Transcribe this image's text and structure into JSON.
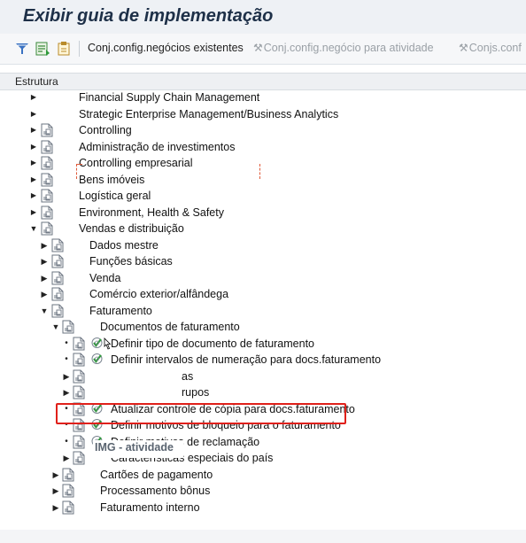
{
  "title": "Exibir guia de implementação",
  "toolbar": {
    "icons": [
      "filter-icon",
      "find-icon",
      "info-icon"
    ],
    "buttons": [
      {
        "label": "Conj.config.negócios existentes",
        "enabled": true
      },
      {
        "label": "Conj.config.negócio para atividade",
        "enabled": false
      },
      {
        "label": "Conjs.conf",
        "enabled": false
      }
    ]
  },
  "tree": {
    "header": "Estrutura",
    "rows": [
      {
        "label": "Financial Supply Chain Management",
        "level": 0,
        "expander": "collapsed",
        "icon": "none"
      },
      {
        "label": "Strategic Enterprise Management/Business Analytics",
        "level": 0,
        "expander": "collapsed",
        "icon": "none"
      },
      {
        "label": "Controlling",
        "level": 0,
        "expander": "collapsed",
        "icon": "doc"
      },
      {
        "label": "Administração de investimentos",
        "level": 0,
        "expander": "collapsed",
        "icon": "doc"
      },
      {
        "label": "Controlling empresarial",
        "level": 0,
        "expander": "collapsed",
        "icon": "doc"
      },
      {
        "label": "Bens imóveis",
        "level": 0,
        "expander": "collapsed",
        "icon": "doc"
      },
      {
        "label": "Logística geral",
        "level": 0,
        "expander": "collapsed",
        "icon": "doc"
      },
      {
        "label": "Environment, Health & Safety",
        "level": 0,
        "expander": "collapsed",
        "icon": "doc"
      },
      {
        "label": "Vendas e distribuição",
        "level": 0,
        "expander": "expanded",
        "icon": "doc"
      },
      {
        "label": "Dados mestre",
        "level": 1,
        "expander": "collapsed",
        "icon": "doc"
      },
      {
        "label": "Funções básicas",
        "level": 1,
        "expander": "collapsed",
        "icon": "doc"
      },
      {
        "label": "Venda",
        "level": 1,
        "expander": "collapsed",
        "icon": "doc"
      },
      {
        "label": "Comércio exterior/alfândega",
        "level": 1,
        "expander": "collapsed",
        "icon": "doc"
      },
      {
        "label": "Faturamento",
        "level": 1,
        "expander": "expanded",
        "icon": "doc"
      },
      {
        "label": "Documentos de faturamento",
        "level": 2,
        "expander": "expanded",
        "icon": "doc"
      },
      {
        "label": "Definir tipo de documento de faturamento",
        "level": 3,
        "expander": "leaf",
        "icon": "doc-activity"
      },
      {
        "label": "Definir intervalos de numeração para docs.faturamento",
        "level": 3,
        "expander": "leaf",
        "icon": "doc-activity"
      },
      {
        "label": "as",
        "level": 3,
        "expander": "collapsed",
        "icon": "doc"
      },
      {
        "label": "rupos",
        "level": 3,
        "expander": "collapsed",
        "icon": "doc"
      },
      {
        "label": "Atualizar controle de cópia para docs.faturamento",
        "level": 3,
        "expander": "leaf",
        "icon": "doc-activity"
      },
      {
        "label": "Definir motivos de bloqueio para o faturamento",
        "level": 3,
        "expander": "leaf",
        "icon": "doc-activity"
      },
      {
        "label": "Definir motivos de reclamação",
        "level": 3,
        "expander": "leaf",
        "icon": "doc-activity"
      },
      {
        "label": "Características especiais do país",
        "level": 3,
        "expander": "collapsed",
        "icon": "doc"
      },
      {
        "label": "Cartões de pagamento",
        "level": 2,
        "expander": "collapsed",
        "icon": "doc"
      },
      {
        "label": "Processamento bônus",
        "level": 2,
        "expander": "collapsed",
        "icon": "doc"
      },
      {
        "label": "Faturamento interno",
        "level": 2,
        "expander": "collapsed",
        "icon": "doc"
      }
    ]
  },
  "tooltip": "IMG - atividade",
  "colors": {
    "title": "#1e3048",
    "highlight": "#e0201a",
    "activity_icon": "#2e9a3a",
    "doc_icon": "#6b7480"
  }
}
